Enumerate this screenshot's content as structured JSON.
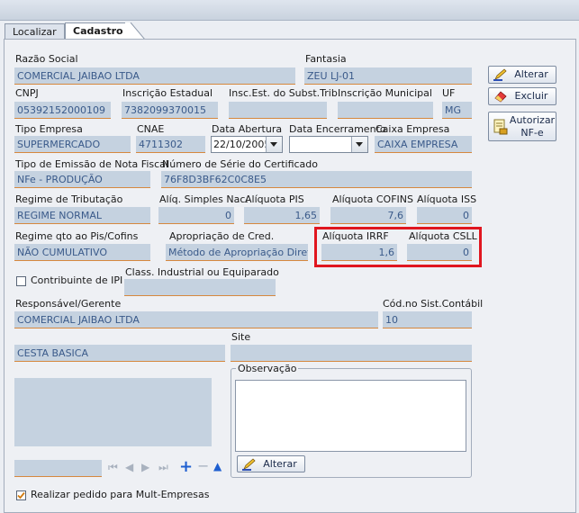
{
  "tabs": {
    "localizar": "Localizar",
    "cadastro": "Cadastro"
  },
  "form": {
    "razao_social": {
      "label": "Razão Social",
      "value": "COMERCIAL JAIBAO LTDA"
    },
    "fantasia": {
      "label": "Fantasia",
      "value": "ZEU LJ-01"
    },
    "cnpj": {
      "label": "CNPJ",
      "value": "05392152000109"
    },
    "inscricao_estadual": {
      "label": "Inscrição Estadual",
      "value": "7382099370015"
    },
    "insc_subst": {
      "label": "Insc.Est. do Subst.Trib.",
      "value": ""
    },
    "inscricao_municipal": {
      "label": "Inscrição Municipal",
      "value": ""
    },
    "uf": {
      "label": "UF",
      "value": "MG"
    },
    "tipo_empresa": {
      "label": "Tipo Empresa",
      "value": "SUPERMERCADO"
    },
    "cnae": {
      "label": "CNAE",
      "value": "4711302"
    },
    "data_abertura": {
      "label": "Data Abertura",
      "value": "22/10/2005"
    },
    "data_encerramento": {
      "label": "Data Encerramento",
      "value": ""
    },
    "caixa_empresa": {
      "label": "Caixa Empresa",
      "value": "CAIXA EMPRESA"
    },
    "tipo_emissao": {
      "label": "Tipo de Emissão de Nota Fiscal",
      "value": "NFe - PRODUÇÃO"
    },
    "numero_serie": {
      "label": "Número de Série do Certificado",
      "value": "76F8D3BF62C0C8E5"
    },
    "regime_tributacao": {
      "label": "Regime de Tributação",
      "value": "REGIME NORMAL"
    },
    "aliq_simples": {
      "label": "Alíq. Simples Nac.",
      "value": "0"
    },
    "aliq_pis": {
      "label": "Alíquota PIS",
      "value": "1,65"
    },
    "aliq_cofins": {
      "label": "Alíquota COFINS",
      "value": "7,6"
    },
    "aliq_iss": {
      "label": "Alíquota ISS",
      "value": "0"
    },
    "regime_pis_cofins": {
      "label": "Regime qto ao Pis/Cofins",
      "value": "NÃO CUMULATIVO"
    },
    "apropriacao": {
      "label": "Apropriação de Cred.",
      "value": "Método de Apropriação Direta"
    },
    "aliq_irrf": {
      "label": "Alíquota IRRF",
      "value": "1,6"
    },
    "aliq_csll": {
      "label": "Alíquota CSLL",
      "value": "0"
    },
    "contribuinte_ipi": {
      "label": "Contribuinte de IPI"
    },
    "class_industrial": {
      "label": "Class. Industrial ou Equiparado",
      "value": ""
    },
    "responsavel": {
      "label": "Responsável/Gerente",
      "value": "COMERCIAL JAIBAO LTDA"
    },
    "cod_contabil": {
      "label": "Cód.no Sist.Contábil",
      "value": "10"
    },
    "cesta": {
      "value": "CESTA BASICA"
    },
    "site": {
      "label": "Site",
      "value": ""
    },
    "observacao": {
      "label": "Observação"
    },
    "realizar_pedido": {
      "label": "Realizar pedido para Mult-Empresas"
    }
  },
  "buttons": {
    "alterar": "Alterar",
    "excluir": "Excluir",
    "autorizar_line1": "Autorizar",
    "autorizar_line2": "NF-e",
    "alterar_obs": "Alterar"
  }
}
